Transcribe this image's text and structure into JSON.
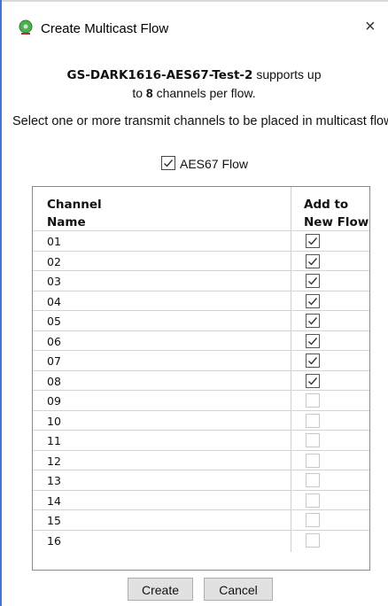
{
  "window": {
    "title": "Create Multicast Flow",
    "close_glyph": "×"
  },
  "info": {
    "device": "GS-DARK1616-AES67-Test-2",
    "supports_text": " supports up",
    "to_text": "to ",
    "channel_count": "8",
    "per_flow_text": " channels per flow.",
    "instruction": "Select one or more transmit channels to be placed in multicast flows."
  },
  "aes67": {
    "label": "AES67 Flow",
    "checked": true
  },
  "table": {
    "col1_line1": "Channel",
    "col1_line2": "Name",
    "col2_line1": "Add to",
    "col2_line2": "New Flow",
    "rows": [
      {
        "name": "01",
        "checked": true
      },
      {
        "name": "02",
        "checked": true
      },
      {
        "name": "03",
        "checked": true
      },
      {
        "name": "04",
        "checked": true
      },
      {
        "name": "05",
        "checked": true
      },
      {
        "name": "06",
        "checked": true
      },
      {
        "name": "07",
        "checked": true
      },
      {
        "name": "08",
        "checked": true
      },
      {
        "name": "09",
        "checked": false
      },
      {
        "name": "10",
        "checked": false
      },
      {
        "name": "11",
        "checked": false
      },
      {
        "name": "12",
        "checked": false
      },
      {
        "name": "13",
        "checked": false
      },
      {
        "name": "14",
        "checked": false
      },
      {
        "name": "15",
        "checked": false
      },
      {
        "name": "16",
        "checked": false
      }
    ]
  },
  "buttons": {
    "create": "Create",
    "cancel": "Cancel"
  },
  "icons": {
    "app": "green-gear-icon",
    "close": "close-icon",
    "check": "checkmark-icon"
  },
  "colors": {
    "window_border": "#3c78d8",
    "app_icon": "#4caf50"
  }
}
